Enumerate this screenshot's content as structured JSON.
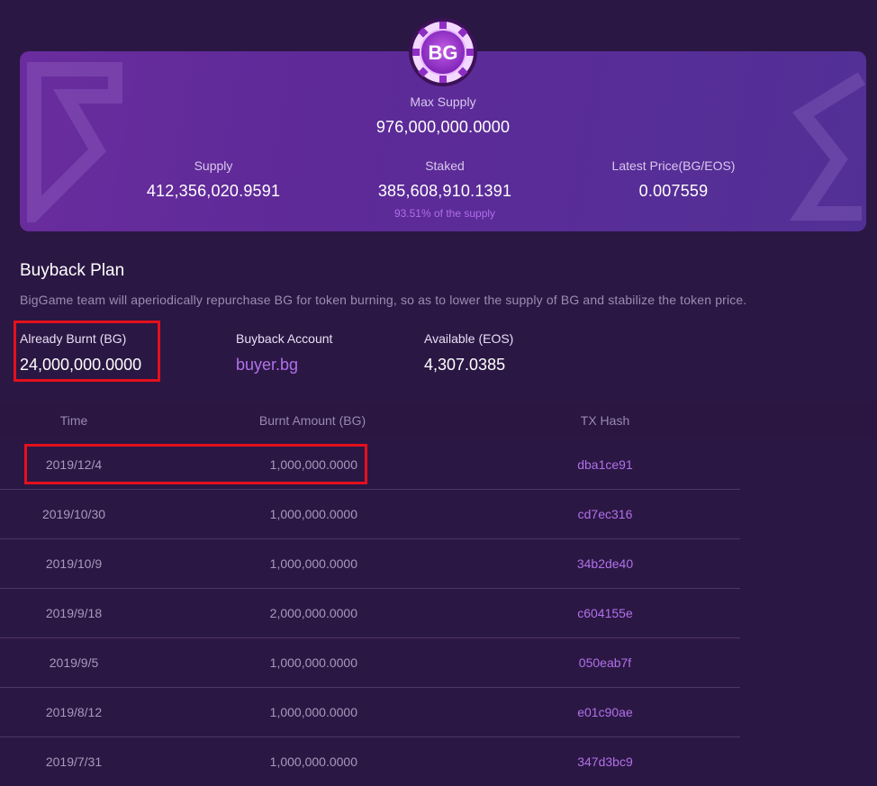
{
  "summary": {
    "max_supply_label": "Max Supply",
    "max_supply_value": "976,000,000.0000",
    "supply_label": "Supply",
    "supply_value": "412,356,020.9591",
    "staked_label": "Staked",
    "staked_value": "385,608,910.1391",
    "staked_note": "93.51% of the supply",
    "price_label": "Latest Price(BG/EOS)",
    "price_value": "0.007559"
  },
  "buyback": {
    "title": "Buyback Plan",
    "description": "BigGame team will aperiodically repurchase BG for token burning, so as to lower the supply of BG and stabilize the token price.",
    "burnt_label": "Already Burnt (BG)",
    "burnt_value": "24,000,000.0000",
    "account_label": "Buyback Account",
    "account_value": "buyer.bg",
    "available_label": "Available (EOS)",
    "available_value": "4,307.0385"
  },
  "table": {
    "headers": [
      "Time",
      "Burnt Amount (BG)",
      "TX Hash"
    ],
    "rows": [
      {
        "time": "2019/12/4",
        "amount": "1,000,000.0000",
        "hash": "dba1ce91"
      },
      {
        "time": "2019/10/30",
        "amount": "1,000,000.0000",
        "hash": "cd7ec316"
      },
      {
        "time": "2019/10/9",
        "amount": "1,000,000.0000",
        "hash": "34b2de40"
      },
      {
        "time": "2019/9/18",
        "amount": "2,000,000.0000",
        "hash": "c604155e"
      },
      {
        "time": "2019/9/5",
        "amount": "1,000,000.0000",
        "hash": "050eab7f"
      },
      {
        "time": "2019/8/12",
        "amount": "1,000,000.0000",
        "hash": "e01c90ae"
      },
      {
        "time": "2019/7/31",
        "amount": "1,000,000.0000",
        "hash": "347d3bc9"
      }
    ]
  },
  "logo": {
    "text": "BG"
  },
  "colors": {
    "background": "#2b1743",
    "accent": "#b071ea",
    "highlight_box": "#e3101d"
  }
}
